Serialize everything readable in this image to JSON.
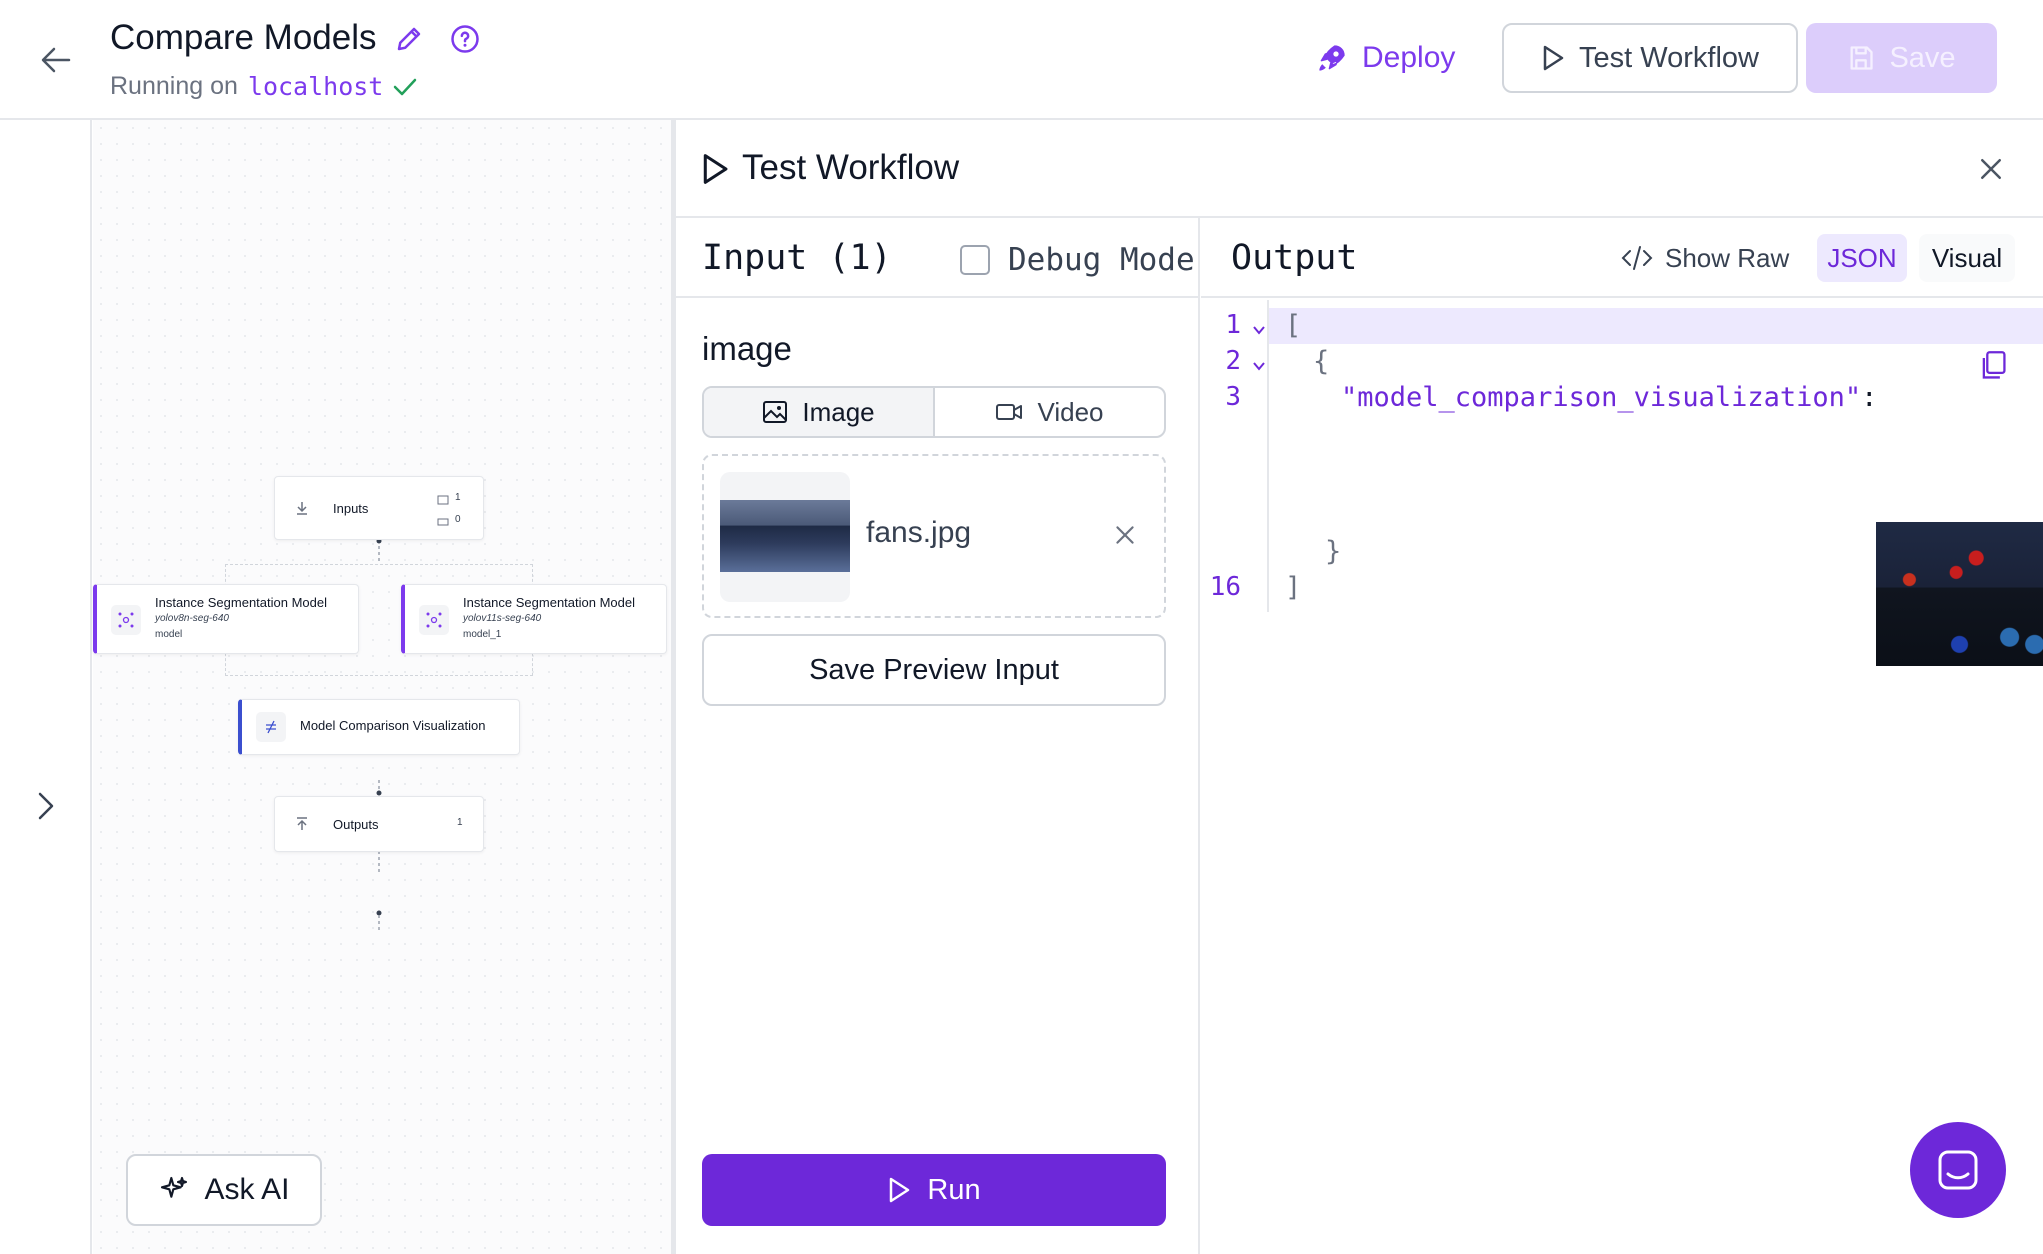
{
  "header": {
    "title": "Compare Models",
    "status_prefix": "Running on",
    "host": "localhost",
    "deploy_label": "Deploy",
    "test_label": "Test Workflow",
    "save_label": "Save"
  },
  "canvas": {
    "nodes": {
      "inputs": {
        "label": "Inputs",
        "image_count": "1",
        "video_count": "0"
      },
      "model_a": {
        "label": "Instance Segmentation Model",
        "model_id": "yolov8n-seg-640",
        "name": "model"
      },
      "model_b": {
        "label": "Instance Segmentation Model",
        "model_id": "yolov11s-seg-640",
        "name": "model_1"
      },
      "viz": {
        "label": "Model Comparison Visualization"
      },
      "outputs": {
        "label": "Outputs",
        "count": "1"
      }
    },
    "ask_ai_label": "Ask AI"
  },
  "test_panel": {
    "title": "Test Workflow",
    "input": {
      "title": "Input (1)",
      "debug_label": "Debug Mode",
      "debug_checked": false,
      "field_label": "image",
      "tabs": [
        "Image",
        "Video"
      ],
      "active_tab": "Image",
      "file_name": "fans.jpg",
      "save_preview_label": "Save Preview Input",
      "run_label": "Run"
    },
    "output": {
      "title": "Output",
      "show_raw_label": "Show Raw",
      "json_label": "JSON",
      "visual_label": "Visual",
      "active_view": "JSON",
      "lines": [
        {
          "num": "1",
          "text": "["
        },
        {
          "num": "2",
          "text": "{"
        },
        {
          "num": "3",
          "key": "\"model_comparison_visualization\"",
          "sep": ":"
        },
        {
          "num": "",
          "text": "}"
        },
        {
          "num": "16",
          "text": "]"
        }
      ]
    }
  },
  "colors": {
    "accent": "#6d28d9",
    "accent_light": "#ede9fe",
    "save_disabled": "#dccdfb"
  },
  "icons": [
    "back-arrow-icon",
    "pencil-icon",
    "help-icon",
    "check-icon",
    "rocket-icon",
    "play-icon",
    "save-icon",
    "chevron-right-icon",
    "close-icon",
    "image-icon",
    "video-icon",
    "code-icon",
    "copy-icon",
    "sparkles-icon",
    "chat-icon"
  ]
}
